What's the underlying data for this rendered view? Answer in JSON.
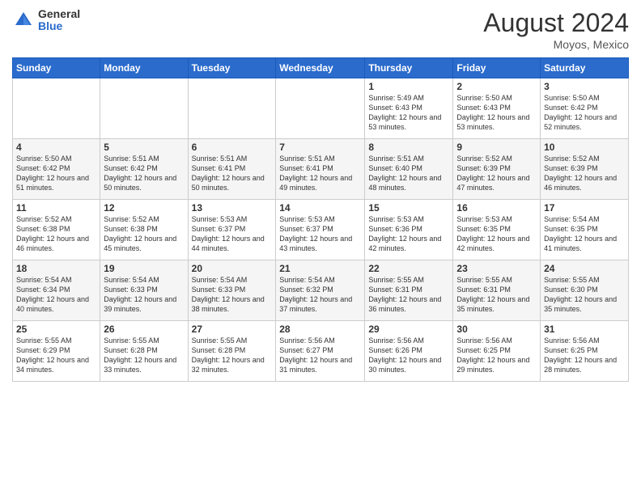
{
  "logo": {
    "general": "General",
    "blue": "Blue"
  },
  "header": {
    "month_year": "August 2024",
    "location": "Moyos, Mexico"
  },
  "weekdays": [
    "Sunday",
    "Monday",
    "Tuesday",
    "Wednesday",
    "Thursday",
    "Friday",
    "Saturday"
  ],
  "weeks": [
    [
      {
        "day": "",
        "sunrise": "",
        "sunset": "",
        "daylight": ""
      },
      {
        "day": "",
        "sunrise": "",
        "sunset": "",
        "daylight": ""
      },
      {
        "day": "",
        "sunrise": "",
        "sunset": "",
        "daylight": ""
      },
      {
        "day": "",
        "sunrise": "",
        "sunset": "",
        "daylight": ""
      },
      {
        "day": "1",
        "sunrise": "Sunrise: 5:49 AM",
        "sunset": "Sunset: 6:43 PM",
        "daylight": "Daylight: 12 hours and 53 minutes."
      },
      {
        "day": "2",
        "sunrise": "Sunrise: 5:50 AM",
        "sunset": "Sunset: 6:43 PM",
        "daylight": "Daylight: 12 hours and 53 minutes."
      },
      {
        "day": "3",
        "sunrise": "Sunrise: 5:50 AM",
        "sunset": "Sunset: 6:42 PM",
        "daylight": "Daylight: 12 hours and 52 minutes."
      }
    ],
    [
      {
        "day": "4",
        "sunrise": "Sunrise: 5:50 AM",
        "sunset": "Sunset: 6:42 PM",
        "daylight": "Daylight: 12 hours and 51 minutes."
      },
      {
        "day": "5",
        "sunrise": "Sunrise: 5:51 AM",
        "sunset": "Sunset: 6:42 PM",
        "daylight": "Daylight: 12 hours and 50 minutes."
      },
      {
        "day": "6",
        "sunrise": "Sunrise: 5:51 AM",
        "sunset": "Sunset: 6:41 PM",
        "daylight": "Daylight: 12 hours and 50 minutes."
      },
      {
        "day": "7",
        "sunrise": "Sunrise: 5:51 AM",
        "sunset": "Sunset: 6:41 PM",
        "daylight": "Daylight: 12 hours and 49 minutes."
      },
      {
        "day": "8",
        "sunrise": "Sunrise: 5:51 AM",
        "sunset": "Sunset: 6:40 PM",
        "daylight": "Daylight: 12 hours and 48 minutes."
      },
      {
        "day": "9",
        "sunrise": "Sunrise: 5:52 AM",
        "sunset": "Sunset: 6:39 PM",
        "daylight": "Daylight: 12 hours and 47 minutes."
      },
      {
        "day": "10",
        "sunrise": "Sunrise: 5:52 AM",
        "sunset": "Sunset: 6:39 PM",
        "daylight": "Daylight: 12 hours and 46 minutes."
      }
    ],
    [
      {
        "day": "11",
        "sunrise": "Sunrise: 5:52 AM",
        "sunset": "Sunset: 6:38 PM",
        "daylight": "Daylight: 12 hours and 46 minutes."
      },
      {
        "day": "12",
        "sunrise": "Sunrise: 5:52 AM",
        "sunset": "Sunset: 6:38 PM",
        "daylight": "Daylight: 12 hours and 45 minutes."
      },
      {
        "day": "13",
        "sunrise": "Sunrise: 5:53 AM",
        "sunset": "Sunset: 6:37 PM",
        "daylight": "Daylight: 12 hours and 44 minutes."
      },
      {
        "day": "14",
        "sunrise": "Sunrise: 5:53 AM",
        "sunset": "Sunset: 6:37 PM",
        "daylight": "Daylight: 12 hours and 43 minutes."
      },
      {
        "day": "15",
        "sunrise": "Sunrise: 5:53 AM",
        "sunset": "Sunset: 6:36 PM",
        "daylight": "Daylight: 12 hours and 42 minutes."
      },
      {
        "day": "16",
        "sunrise": "Sunrise: 5:53 AM",
        "sunset": "Sunset: 6:35 PM",
        "daylight": "Daylight: 12 hours and 42 minutes."
      },
      {
        "day": "17",
        "sunrise": "Sunrise: 5:54 AM",
        "sunset": "Sunset: 6:35 PM",
        "daylight": "Daylight: 12 hours and 41 minutes."
      }
    ],
    [
      {
        "day": "18",
        "sunrise": "Sunrise: 5:54 AM",
        "sunset": "Sunset: 6:34 PM",
        "daylight": "Daylight: 12 hours and 40 minutes."
      },
      {
        "day": "19",
        "sunrise": "Sunrise: 5:54 AM",
        "sunset": "Sunset: 6:33 PM",
        "daylight": "Daylight: 12 hours and 39 minutes."
      },
      {
        "day": "20",
        "sunrise": "Sunrise: 5:54 AM",
        "sunset": "Sunset: 6:33 PM",
        "daylight": "Daylight: 12 hours and 38 minutes."
      },
      {
        "day": "21",
        "sunrise": "Sunrise: 5:54 AM",
        "sunset": "Sunset: 6:32 PM",
        "daylight": "Daylight: 12 hours and 37 minutes."
      },
      {
        "day": "22",
        "sunrise": "Sunrise: 5:55 AM",
        "sunset": "Sunset: 6:31 PM",
        "daylight": "Daylight: 12 hours and 36 minutes."
      },
      {
        "day": "23",
        "sunrise": "Sunrise: 5:55 AM",
        "sunset": "Sunset: 6:31 PM",
        "daylight": "Daylight: 12 hours and 35 minutes."
      },
      {
        "day": "24",
        "sunrise": "Sunrise: 5:55 AM",
        "sunset": "Sunset: 6:30 PM",
        "daylight": "Daylight: 12 hours and 35 minutes."
      }
    ],
    [
      {
        "day": "25",
        "sunrise": "Sunrise: 5:55 AM",
        "sunset": "Sunset: 6:29 PM",
        "daylight": "Daylight: 12 hours and 34 minutes."
      },
      {
        "day": "26",
        "sunrise": "Sunrise: 5:55 AM",
        "sunset": "Sunset: 6:28 PM",
        "daylight": "Daylight: 12 hours and 33 minutes."
      },
      {
        "day": "27",
        "sunrise": "Sunrise: 5:55 AM",
        "sunset": "Sunset: 6:28 PM",
        "daylight": "Daylight: 12 hours and 32 minutes."
      },
      {
        "day": "28",
        "sunrise": "Sunrise: 5:56 AM",
        "sunset": "Sunset: 6:27 PM",
        "daylight": "Daylight: 12 hours and 31 minutes."
      },
      {
        "day": "29",
        "sunrise": "Sunrise: 5:56 AM",
        "sunset": "Sunset: 6:26 PM",
        "daylight": "Daylight: 12 hours and 30 minutes."
      },
      {
        "day": "30",
        "sunrise": "Sunrise: 5:56 AM",
        "sunset": "Sunset: 6:25 PM",
        "daylight": "Daylight: 12 hours and 29 minutes."
      },
      {
        "day": "31",
        "sunrise": "Sunrise: 5:56 AM",
        "sunset": "Sunset: 6:25 PM",
        "daylight": "Daylight: 12 hours and 28 minutes."
      }
    ]
  ]
}
